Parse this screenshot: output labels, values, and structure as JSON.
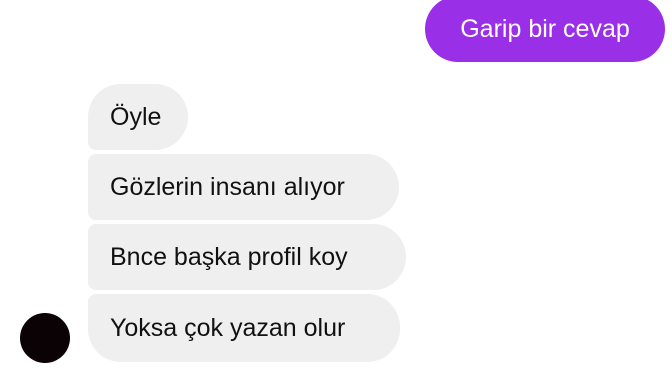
{
  "conversation": {
    "sent_messages": [
      {
        "text": "Garip bir cevap"
      }
    ],
    "received_messages": [
      {
        "text": "Öyle"
      },
      {
        "text": "Gözlerin insanı alıyor"
      },
      {
        "text": "Bnce başka profil koy"
      },
      {
        "text": "Yoksa çok yazan olur"
      }
    ]
  },
  "colors": {
    "sent_bubble": "#9a2fe8",
    "received_bubble": "#efefef",
    "avatar": "#0a0204"
  }
}
